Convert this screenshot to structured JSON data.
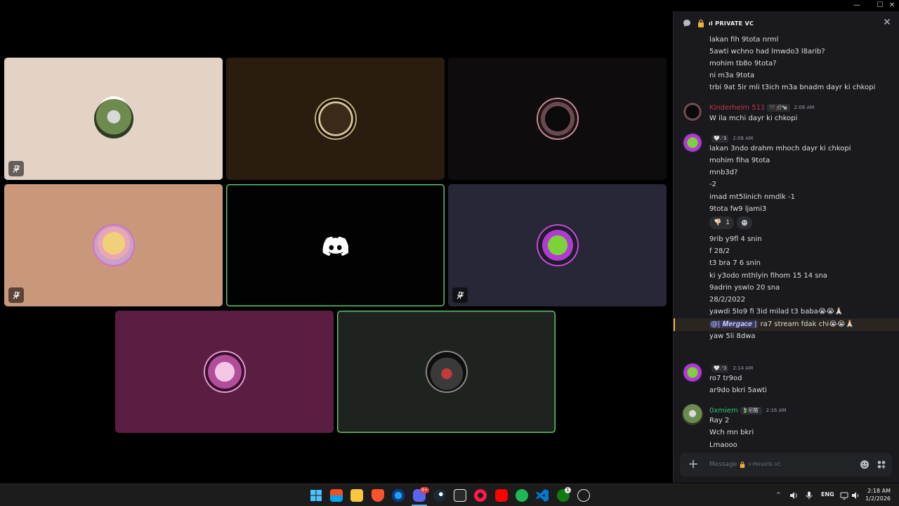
{
  "window": {
    "minimize_icon": "minimize-icon",
    "maximize_icon": "maximize-icon",
    "close_icon": "close-icon"
  },
  "stage": {
    "logo_icon": "discord-logo-icon",
    "tiles": [
      {
        "bg": "#e2d3c6",
        "muted": true
      },
      {
        "bg": "#2a1d10",
        "muted": false
      },
      {
        "bg": "#0e0c0c",
        "muted": false
      },
      {
        "bg": "#c9977a",
        "muted": true
      },
      {
        "bg": "#020202",
        "muted": false,
        "speaking": true
      },
      {
        "bg": "#272737",
        "muted": true
      },
      {
        "bg": "#5a1e42",
        "muted": false
      },
      {
        "bg": "#1f231f",
        "muted": false,
        "speaking": true
      }
    ]
  },
  "panel": {
    "title": "ıl PRIVATE VC",
    "chat_icon": "chat-bubble-icon",
    "lock_icon": "lock-icon",
    "messages": [
      {
        "text": "lakan fih 9tota nrml"
      },
      {
        "text": "5awti wchno had lmwdo3 l8arib?"
      },
      {
        "text": "mohim tb8o 9tota?"
      },
      {
        "text": "ni m3a 9tota"
      },
      {
        "text": "trbi 9at 5ir mli t3ich m3a bnadm dayr ki chkopi"
      }
    ],
    "groups": [
      {
        "author": "Kinderheim 511",
        "author_color": "#c03545",
        "tag": "🖤🎢🐄",
        "time": "2:06 AM",
        "lines": [
          "W ila mchi dayr ki chkopi"
        ]
      },
      {
        "author": "",
        "author_color": "#c03545",
        "tag": "🤍.ᐟ3",
        "time": "2:06 AM",
        "lines": [
          "lakan 3ndo drahm mhoch dayr ki chkopi",
          "mohim fiha 9tota",
          "mnb3d?",
          "-2",
          "imad mt5linich nmdlk -1",
          "9tota fw9 ljami3"
        ],
        "reaction": {
          "emoji": "👎🏻",
          "count": "1"
        },
        "lines_after": [
          "9rib y9fl 4 snin",
          "f 28/2",
          "t3 bra 7 6 snin",
          "ki y3odo mthlyin fihom 15 14 sna",
          "9adrin yswlo 20 sna",
          "28/2/2022",
          "yawdi 5lo9 fi 3id milad t3 baba😭😭🙏🏻"
        ],
        "mention": "@| 𝑴𝒆𝒓𝒈𝒂𝒄𝒆 |",
        "mention_rest": " ra7 stream fdak chi😭😭🙏🏻",
        "last": "yaw 5li 8dwa"
      },
      {
        "author": "",
        "author_color": "#c03545",
        "tag": "🤍.ᐟ3",
        "time": "2:14 AM",
        "lines": [
          "ro7 tr9od",
          "ar9do bkri 5awti"
        ]
      },
      {
        "author": "0xmiem",
        "author_color": "#2dc770",
        "tag": "🍃尼酷 ̈",
        "time": "2:16 AM",
        "lines": [
          "Ray 2",
          "Wch mn bkri",
          "Lmaooo"
        ]
      }
    ],
    "composer": {
      "placeholder_prefix": "Message",
      "placeholder_channel": "ıl PRIVATE VC",
      "add_icon": "plus-icon",
      "emoji_icon": "emoji-icon",
      "apps_icon": "apps-icon"
    }
  },
  "taskbar": {
    "apps": [
      "windows-start-icon",
      "microsoft-store-icon",
      "file-explorer-icon",
      "brave-browser-icon",
      "edge-browser-icon",
      "discord-app-icon",
      "steam-icon",
      "epic-games-icon",
      "music-app-icon",
      "youtube-icon",
      "spotify-icon",
      "vscode-icon",
      "xbox-icon",
      "app-circle-icon"
    ],
    "discord_badge": "9+",
    "xbox_badge": "1",
    "language": "ENG",
    "time": "2:18 AM",
    "date": "1/2/2026"
  }
}
